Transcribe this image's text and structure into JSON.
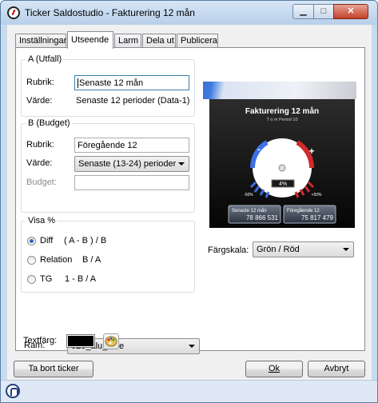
{
  "window": {
    "title": "Ticker Saldostudio - Fakturering 12 mån",
    "min_glyph": "▁",
    "max_glyph": "□",
    "close_glyph": "✕"
  },
  "tabs": [
    {
      "label": "Inställningar",
      "active": false
    },
    {
      "label": "Utseende",
      "active": true
    },
    {
      "label": "Larm",
      "active": false
    },
    {
      "label": "Dela ut",
      "active": false
    },
    {
      "label": "Publicera",
      "active": false
    }
  ],
  "group_a": {
    "legend": "A (Utfall)",
    "rubrik_label": "Rubrik:",
    "rubrik_value": "Senaste 12 mån",
    "varde_label": "Värde:",
    "varde_value": "Senaste 12 perioder (Data-1)"
  },
  "group_b": {
    "legend": "B (Budget)",
    "rubrik_label": "Rubrik:",
    "rubrik_value": "Föregående 12",
    "varde_label": "Värde:",
    "varde_value": "Senaste (13-24) perioder",
    "budget_label": "Budget:",
    "budget_value": ""
  },
  "visa": {
    "legend": "Visa %",
    "options": [
      {
        "label": "Diff",
        "formula": "( A - B ) / B",
        "checked": true
      },
      {
        "label": "Relation",
        "formula": "B / A",
        "checked": false
      },
      {
        "label": "TG",
        "formula": "1 - B / A",
        "checked": false
      }
    ]
  },
  "preview": {
    "title": "Fakturering 12 mån",
    "subtitle": "T o m  Period 10",
    "minus": "-",
    "plus": "+",
    "percent": "4%",
    "left_scale": "-50%",
    "right_scale": "+50%",
    "left_box_label": "Senaste 12 mån",
    "left_box_value": "78 866 531",
    "right_box_label": "Föregående 12",
    "right_box_value": "75 817 479",
    "gauge_fraction": 0.54
  },
  "fargskala": {
    "label": "Färgskala:",
    "value": "Grön / Röd"
  },
  "ram": {
    "label": "Ram:",
    "value": "020_alu_blue"
  },
  "textfarg": {
    "label": "Textfärg:",
    "color": "#000000"
  },
  "buttons": {
    "remove": "Ta bort ticker",
    "ok": "Ok",
    "cancel": "Avbryt"
  },
  "colors": {
    "accent_blue": "#2b69c4",
    "gauge_red": "#d42a2a",
    "gauge_blue": "#3d6fe6"
  }
}
